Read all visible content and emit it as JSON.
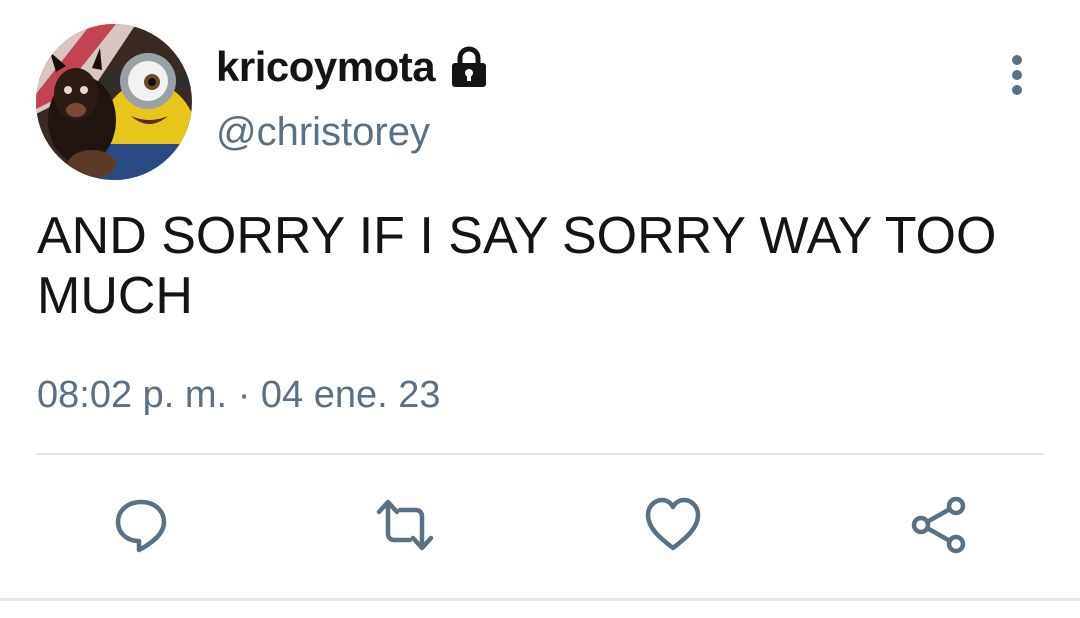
{
  "user": {
    "display_name": "kricoymota",
    "handle": "@christorey",
    "protected": true,
    "lock_icon": "lock-icon",
    "avatar": "avatar-dog-and-minion"
  },
  "tweet": {
    "text": "AND SORRY IF I SAY SORRY WAY TOO MUCH",
    "time": "08:02 p. m.",
    "separator": "·",
    "date": "04 ene. 23"
  },
  "actions": [
    {
      "name": "reply",
      "icon": "reply-icon"
    },
    {
      "name": "retweet",
      "icon": "retweet-icon"
    },
    {
      "name": "like",
      "icon": "heart-icon"
    },
    {
      "name": "share",
      "icon": "share-icon"
    }
  ],
  "colors": {
    "text": "#141414",
    "secondary": "#5b7083",
    "divider": "#e3e7eb"
  }
}
